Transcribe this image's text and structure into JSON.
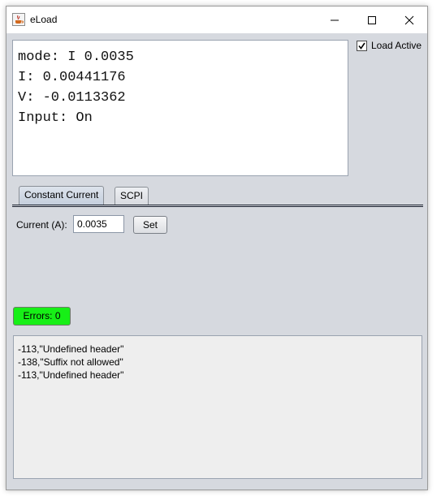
{
  "window": {
    "title": "eLoad",
    "icon": "java-cup-icon"
  },
  "readout": {
    "lines": [
      "mode: I 0.0035",
      "I: 0.00441176",
      "V: -0.0113362",
      "Input: On"
    ]
  },
  "load_active": {
    "label": "Load Active",
    "checked": true
  },
  "tabs": [
    {
      "label": "Constant Current",
      "active": true
    },
    {
      "label": "SCPI",
      "active": false
    }
  ],
  "constant_current": {
    "label": "Current (A):",
    "value": "0.0035",
    "set_label": "Set"
  },
  "errors": {
    "label": "Errors: 0",
    "color": "#17ef17"
  },
  "log": {
    "lines": [
      "-113,\"Undefined header\"",
      "-138,\"Suffix not allowed\"",
      "-113,\"Undefined header\""
    ]
  }
}
